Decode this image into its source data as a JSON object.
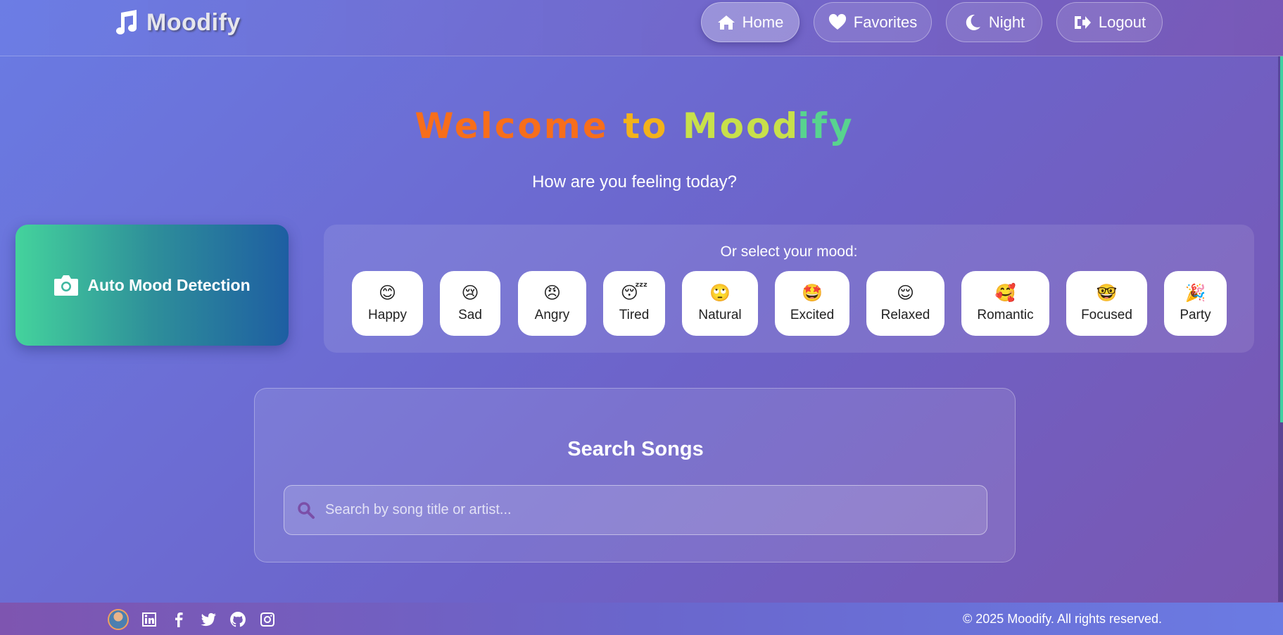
{
  "brand": {
    "name": "Moodify",
    "icon": "music-note-icon"
  },
  "nav": {
    "home": "Home",
    "favorites": "Favorites",
    "night": "Night",
    "logout": "Logout"
  },
  "hero": {
    "welcome_1": "Welcome",
    "welcome_2": "to",
    "welcome_3": "Mood",
    "welcome_4": "ify",
    "subtitle": "How are you feeling today?"
  },
  "auto_detect": {
    "label": "Auto Mood Detection",
    "icon": "camera-icon"
  },
  "moods": {
    "title": "Or select your mood:",
    "items": [
      {
        "label": "Happy",
        "emoji": "😊"
      },
      {
        "label": "Sad",
        "emoji": "😢"
      },
      {
        "label": "Angry",
        "emoji": "😠"
      },
      {
        "label": "Tired",
        "emoji": "😴"
      },
      {
        "label": "Natural",
        "emoji": "🙄"
      },
      {
        "label": "Excited",
        "emoji": "🤩"
      },
      {
        "label": "Relaxed",
        "emoji": "😌"
      },
      {
        "label": "Romantic",
        "emoji": "🥰"
      },
      {
        "label": "Focused",
        "emoji": "🤓"
      },
      {
        "label": "Party",
        "emoji": "🎉"
      }
    ]
  },
  "search": {
    "title": "Search Songs",
    "placeholder": "Search by song title or artist...",
    "value": ""
  },
  "footer": {
    "copyright": "© 2025 Moodify. All rights reserved.",
    "social_icons": [
      "avatar",
      "linkedin-icon",
      "facebook-icon",
      "twitter-icon",
      "github-icon",
      "instagram-icon"
    ]
  },
  "colors": {
    "welcome_orange": "#f76e1b",
    "welcome_yellow": "#f3b21a",
    "welcome_lime": "#c8e04a",
    "welcome_green": "#58d38f",
    "auto_card_start": "#44d39c",
    "auto_card_end": "#1e5ea2",
    "search_icon": "#7b4fa8"
  }
}
